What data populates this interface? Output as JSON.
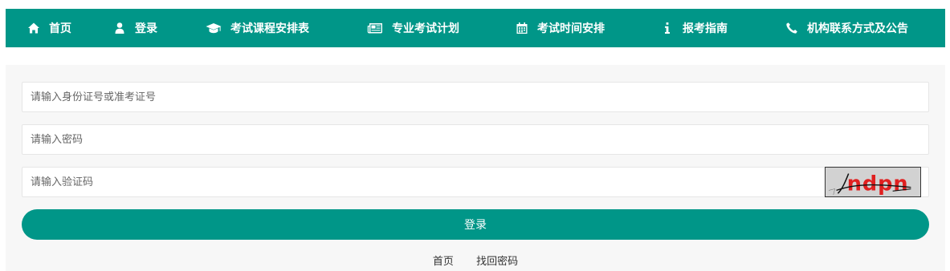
{
  "nav": {
    "items": [
      {
        "label": "首页",
        "icon": "home-icon"
      },
      {
        "label": "登录",
        "icon": "user-icon"
      },
      {
        "label": "考试课程安排表",
        "icon": "graduation-cap-icon"
      },
      {
        "label": "专业考试计划",
        "icon": "newspaper-icon"
      },
      {
        "label": "考试时间安排",
        "icon": "calendar-icon"
      },
      {
        "label": "报考指南",
        "icon": "info-icon"
      },
      {
        "label": "机构联系方式及公告",
        "icon": "phone-icon"
      }
    ]
  },
  "form": {
    "id_placeholder": "请输入身份证号或准考证号",
    "password_placeholder": "请输入密码",
    "captcha_placeholder": "请输入验证码",
    "captcha_text": "ndpn",
    "login_label": "登录"
  },
  "footer_links": {
    "home": "首页",
    "recover": "找回密码"
  },
  "colors": {
    "brand": "#009688",
    "panel_bg": "#f7f7f7",
    "captcha_text": "#e02020"
  }
}
